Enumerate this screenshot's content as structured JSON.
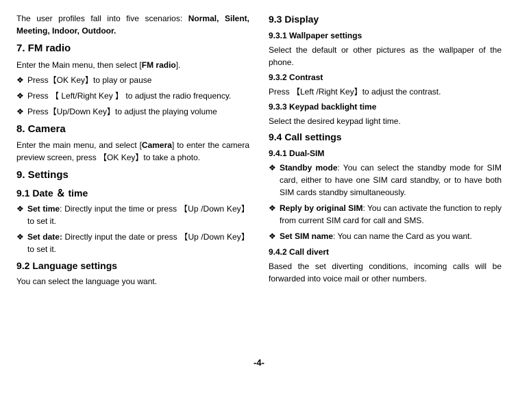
{
  "left": {
    "intro": "The user profiles fall into five scenarios: ",
    "profiles": "Normal, Silent, Meeting, Indoor, Outdoor.",
    "s7": {
      "title": "7. FM radio",
      "p1_a": "Enter the Main menu, then select [",
      "p1_b": "FM radio",
      "p1_c": "].",
      "b1": "Press【OK Key】to play or pause",
      "b2": "Press 【 Left/Right Key 】 to adjust the radio frequency.",
      "b3": "Press【Up/Down Key】to adjust the playing volume"
    },
    "s8": {
      "title": "8. Camera",
      "p1_a": "Enter the main menu, and select [",
      "p1_b": "Camera",
      "p1_c": "] to enter the camera preview screen, press 【OK Key】to take a photo."
    },
    "s9": {
      "title": "9. Settings",
      "s91": {
        "title": "9.1 Date ＆ time",
        "b1_label": "Set time",
        "b1_text": ": Directly input the time or press 【Up /Down Key】to set it.",
        "b2_label": "Set date:",
        "b2_text": " Directly input the date or press 【Up /Down Key】to set it."
      },
      "s92": {
        "title": "9.2 Language settings",
        "p1": "You can select the language you want."
      }
    }
  },
  "right": {
    "s93": {
      "title": "9.3 Display",
      "s931": {
        "title": "9.3.1 Wallpaper settings",
        "p1": "Select the default or other pictures as the wallpaper of the phone."
      },
      "s932": {
        "title": "9.3.2 Contrast",
        "p1": "Press 【Left /Right Key】to adjust the contrast."
      },
      "s933": {
        "title": "9.3.3 Keypad backlight time",
        "p1": "Select the desired keypad light time."
      }
    },
    "s94": {
      "title": "9.4 Call settings",
      "s941": {
        "title": "9.4.1 Dual-SIM",
        "b1_label": "Standby mode",
        "b1_text": ": You can select the standby mode for SIM card, either to have one SIM card standby, or to have both SIM cards standby simultaneously.",
        "b2_label": "Reply by original SIM",
        "b2_text": ": You can activate the function to reply from current SIM card for call and SMS.",
        "b3_label": "Set SIM name",
        "b3_text": ": You can name the Card as you want."
      },
      "s942": {
        "title": "9.4.2 Call divert",
        "p1": "Based the set diverting conditions, incoming calls will be forwarded into voice mail or other numbers."
      }
    }
  },
  "page_number": "-4-",
  "bullet_char": "❖"
}
